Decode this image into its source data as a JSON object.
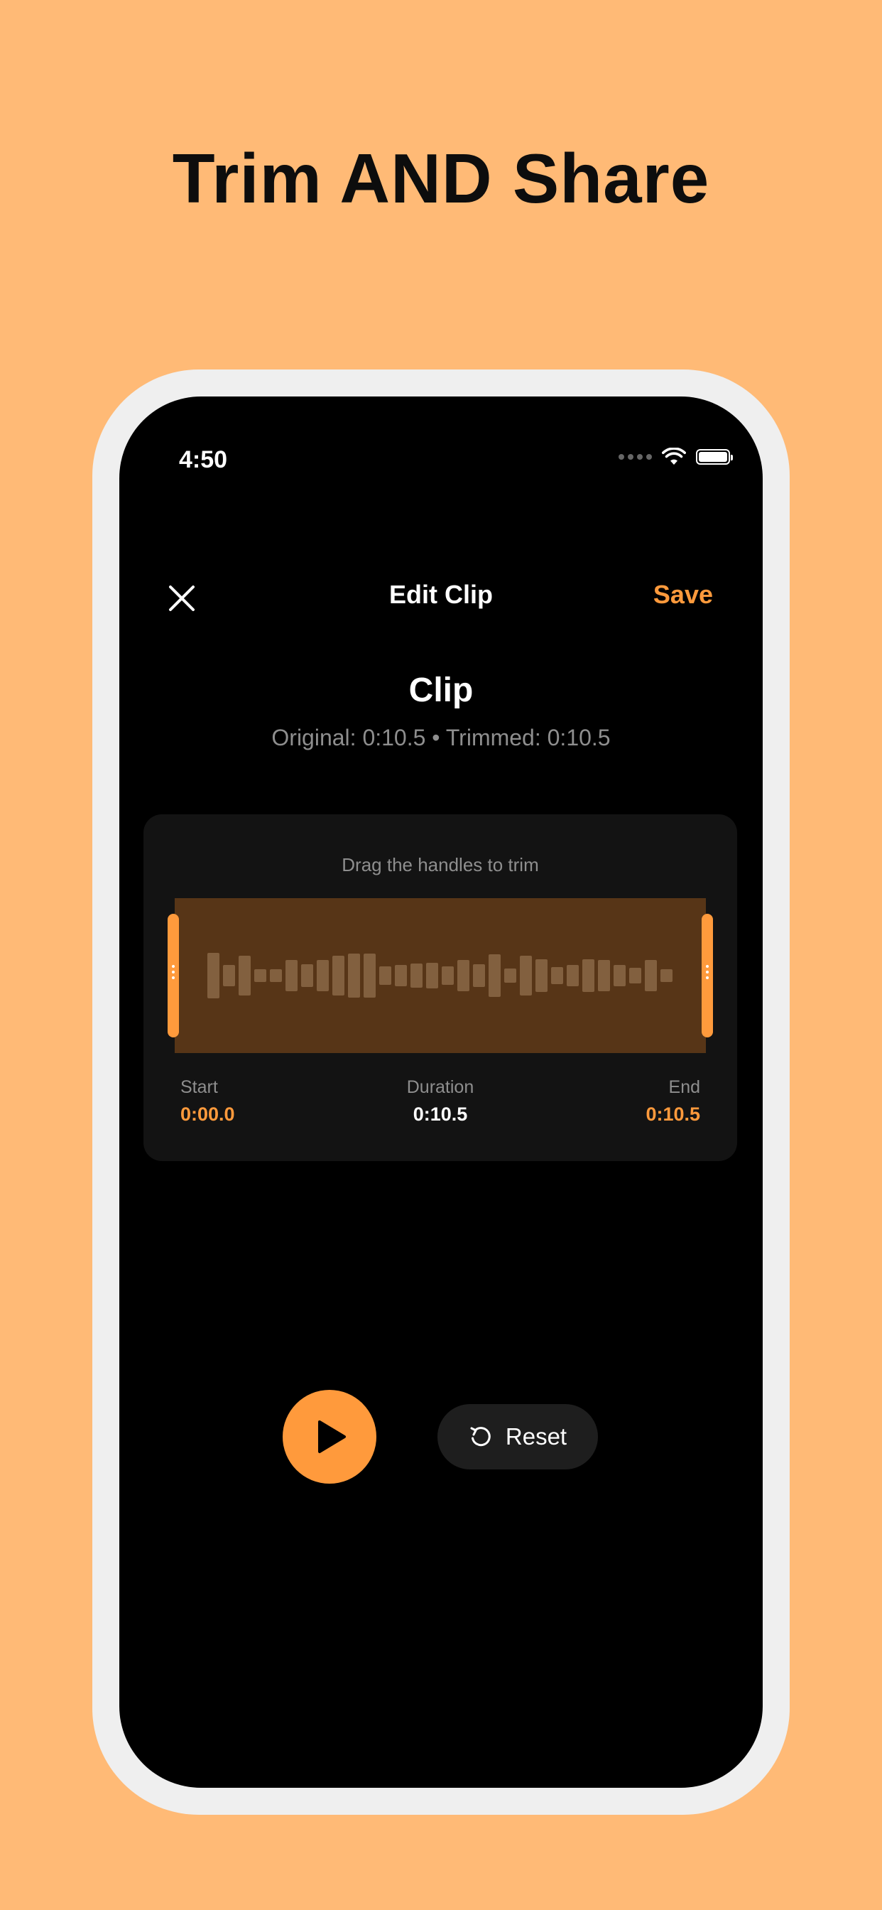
{
  "headline": "Trim AND Share",
  "status_bar": {
    "time": "4:50"
  },
  "nav": {
    "title": "Edit Clip",
    "save_label": "Save"
  },
  "clip": {
    "name": "Clip",
    "meta": "Original: 0:10.5 • Trimmed: 0:10.5"
  },
  "trim": {
    "hint": "Drag the handles to trim",
    "start_label": "Start",
    "start_value": "0:00.0",
    "duration_label": "Duration",
    "duration_value": "0:10.5",
    "end_label": "End",
    "end_value": "0:10.5"
  },
  "controls": {
    "reset_label": "Reset"
  },
  "colors": {
    "accent": "#FF9A3C",
    "background": "#FFBA76",
    "screen": "#000000"
  },
  "icons": [
    "close-icon",
    "wifi-icon",
    "battery-icon",
    "play-icon",
    "reset-icon"
  ]
}
